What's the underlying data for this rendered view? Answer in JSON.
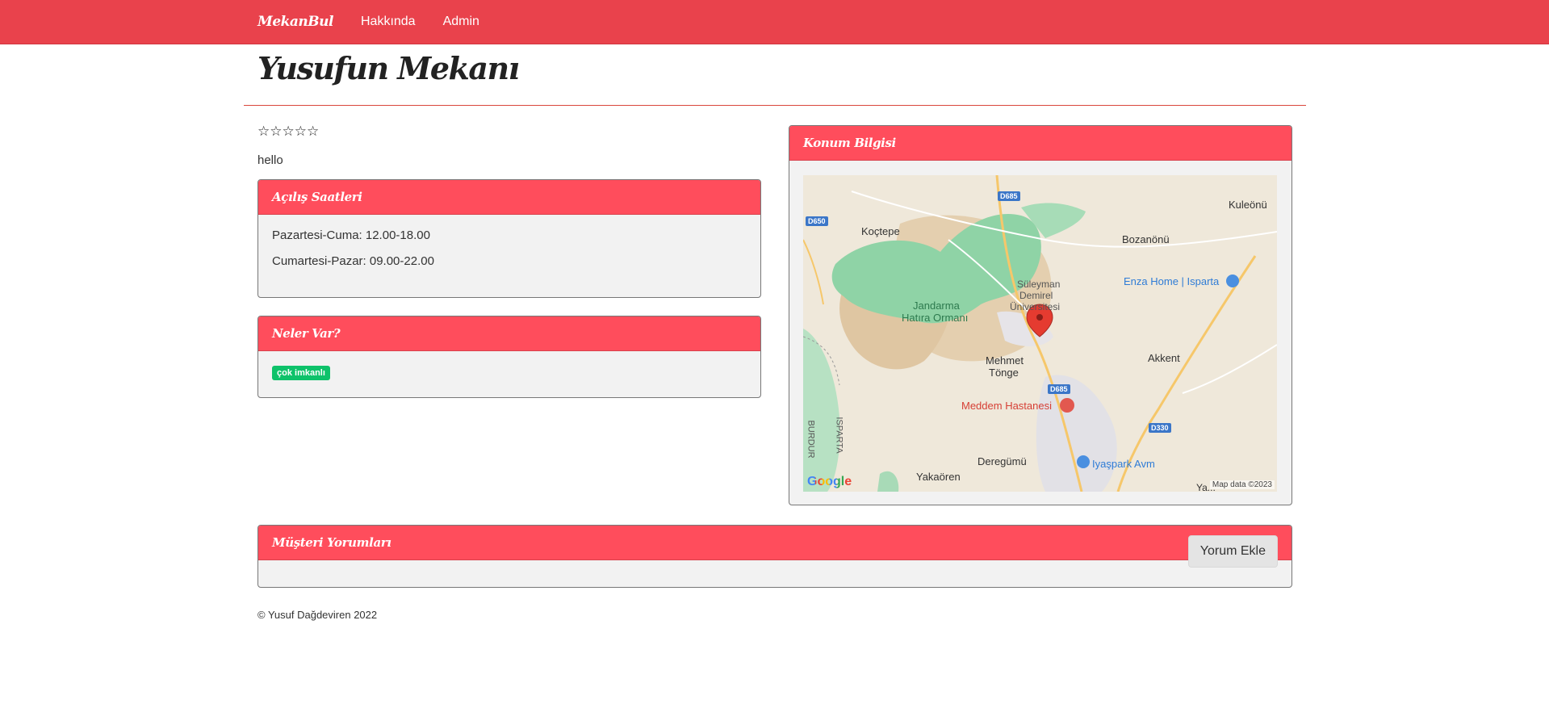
{
  "navbar": {
    "brand": "MekanBul",
    "links": [
      "Hakkında",
      "Admin"
    ]
  },
  "venue": {
    "name": "Yusufun Mekanı",
    "rating_stars": "☆☆☆☆☆",
    "rating_value": 0,
    "rating_max": 5,
    "description": "hello"
  },
  "opening_hours": {
    "title": "Açılış Saatleri",
    "lines": [
      "Pazartesi-Cuma: 12.00-18.00",
      "Cumartesi-Pazar: 09.00-22.00"
    ]
  },
  "amenities": {
    "title": "Neler Var?",
    "items": [
      "çok imkanlı"
    ]
  },
  "location": {
    "title": "Konum Bilgisi",
    "map_labels": {
      "koctepe": "Koçtepe",
      "kuleonu": "Kuleönü",
      "bozanonu": "Bozanönü",
      "enza": "Enza Home | Isparta",
      "suleyman1": "Süleyman",
      "suleyman2": "Demirel",
      "suleyman3": "Üniversitesi",
      "jandarma1": "Jandarma",
      "jandarma2": "Hatıra Ormanı",
      "mehmet1": "Mehmet",
      "mehmet2": "Tönge",
      "akkent": "Akkent",
      "meddem": "Meddem Hastanesi",
      "deregumu": "Deregümü",
      "iyaspark": "Iyaşpark Avm",
      "yakaoren": "Yakaören",
      "burdur": "BURDUR",
      "isparta": "ISPARTA",
      "ya": "Ya...",
      "d650": "D650",
      "d685a": "D685",
      "d685b": "D685",
      "d330": "D330",
      "google": "Google",
      "map_data": "Map data ©2023"
    }
  },
  "reviews": {
    "title": "Müşteri Yorumları",
    "add_button": "Yorum Ekle"
  },
  "footer": {
    "text": "© Yusuf Dağdeviren 2022"
  },
  "colors": {
    "navbar": "#e9424c",
    "panel_header": "#ff4d5c",
    "badge": "#0ec26a"
  }
}
